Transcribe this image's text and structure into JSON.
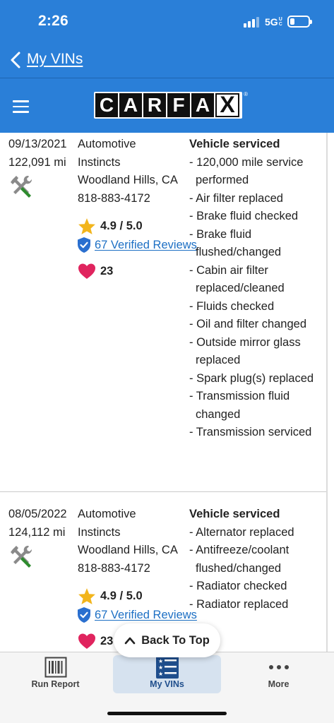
{
  "status_bar": {
    "time": "2:26",
    "network": "5G",
    "network_suffix": "UC"
  },
  "nav": {
    "back_label": "My VINs"
  },
  "brand": {
    "logo_letters": [
      "C",
      "A",
      "R",
      "F",
      "A",
      "X"
    ],
    "registered": "®"
  },
  "records": [
    {
      "date": "09/13/2021",
      "mileage": "122,091 mi",
      "shop_lines": [
        "Automotive",
        "Instincts",
        "Woodland Hills, CA",
        "818-883-4172"
      ],
      "rating": "4.9 / 5.0",
      "reviews_link": "67 Verified Reviews",
      "favorites": "23",
      "service_title": "Vehicle serviced",
      "services": [
        "- 120,000 mile service performed",
        "- Air filter replaced",
        "- Brake fluid checked",
        "- Brake fluid flushed/changed",
        "- Cabin air filter replaced/cleaned",
        "- Fluids checked",
        "- Oil and filter changed",
        "- Outside mirror glass replaced",
        "- Spark plug(s) replaced",
        "- Transmission fluid changed",
        "- Transmission serviced"
      ]
    },
    {
      "date": "08/05/2022",
      "mileage": "124,112 mi",
      "shop_lines": [
        "Automotive",
        "Instincts",
        "Woodland Hills, CA",
        "818-883-4172"
      ],
      "rating": "4.9 / 5.0",
      "reviews_link": "67 Verified Reviews",
      "favorites": "23",
      "service_title": "Vehicle serviced",
      "services": [
        "- Alternator replaced",
        "- Antifreeze/coolant flushed/changed",
        "- Radiator checked",
        "- Radiator replaced"
      ]
    }
  ],
  "back_to_top": {
    "label": "Back To Top"
  },
  "tabs": [
    {
      "label": "Run Report",
      "icon": "barcode-icon",
      "active": false
    },
    {
      "label": "My VINs",
      "icon": "list-icon",
      "active": true
    },
    {
      "label": "More",
      "icon": "more-dots-icon",
      "active": false
    }
  ],
  "colors": {
    "brand_blue": "#2a7fd8",
    "link_blue": "#1c6fc4",
    "star": "#f2b51c",
    "heart": "#e0245e",
    "tab_active_bg": "#d6e2ef"
  }
}
